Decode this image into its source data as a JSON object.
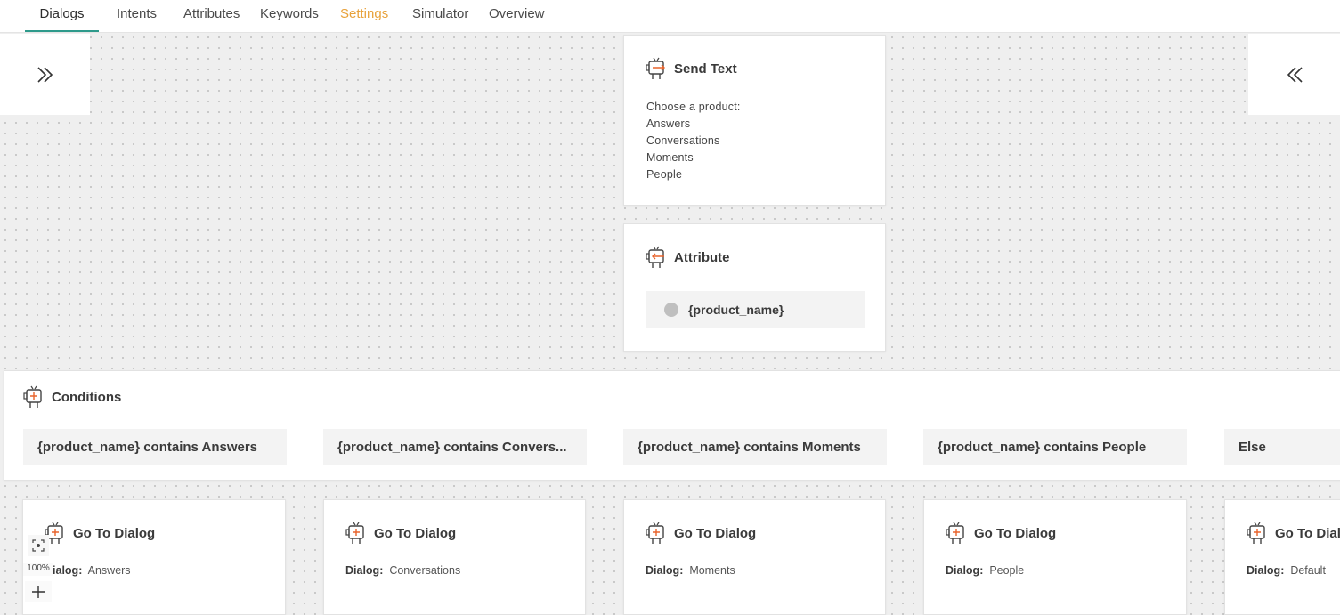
{
  "nav": {
    "tabs": [
      {
        "label": "Dialogs"
      },
      {
        "label": "Intents"
      },
      {
        "label": "Attributes"
      },
      {
        "label": "Keywords"
      },
      {
        "label": "Settings"
      },
      {
        "label": "Simulator"
      },
      {
        "label": "Overview"
      }
    ],
    "active_tab": "Dialogs",
    "highlight_tab": "Settings"
  },
  "send_text": {
    "title": "Send Text",
    "lines": [
      "Choose a product:",
      "Answers",
      "Conversations",
      "Moments",
      "People"
    ]
  },
  "attribute": {
    "title": "Attribute",
    "value": "{product_name}"
  },
  "conditions": {
    "title": "Conditions",
    "items": [
      {
        "label": "{product_name} contains Answers"
      },
      {
        "label": "{product_name} contains Convers..."
      },
      {
        "label": "{product_name} contains Moments"
      },
      {
        "label": "{product_name} contains People"
      },
      {
        "label": "Else"
      }
    ]
  },
  "goto_dialogs": [
    {
      "title": "Go To Dialog",
      "key": "Dialog:",
      "value": "Answers"
    },
    {
      "title": "Go To Dialog",
      "key": "Dialog:",
      "value": "Conversations"
    },
    {
      "title": "Go To Dialog",
      "key": "Dialog:",
      "value": "Moments"
    },
    {
      "title": "Go To Dialog",
      "key": "Dialog:",
      "value": "People"
    },
    {
      "title": "Go To Dialo",
      "key": "Dialog:",
      "value": "Default"
    }
  ],
  "zoom": {
    "level": "100%"
  },
  "colors": {
    "accent": "#2e9a8b",
    "highlight": "#e8a23b",
    "icon_accent": "#e8632b"
  },
  "icons": {
    "expand_left": "double-chevron-right-icon",
    "expand_right": "double-chevron-left-icon",
    "send_text": "bot-send-icon",
    "attribute": "bot-attribute-icon",
    "conditions": "bot-conditions-icon",
    "goto": "bot-goto-icon"
  }
}
